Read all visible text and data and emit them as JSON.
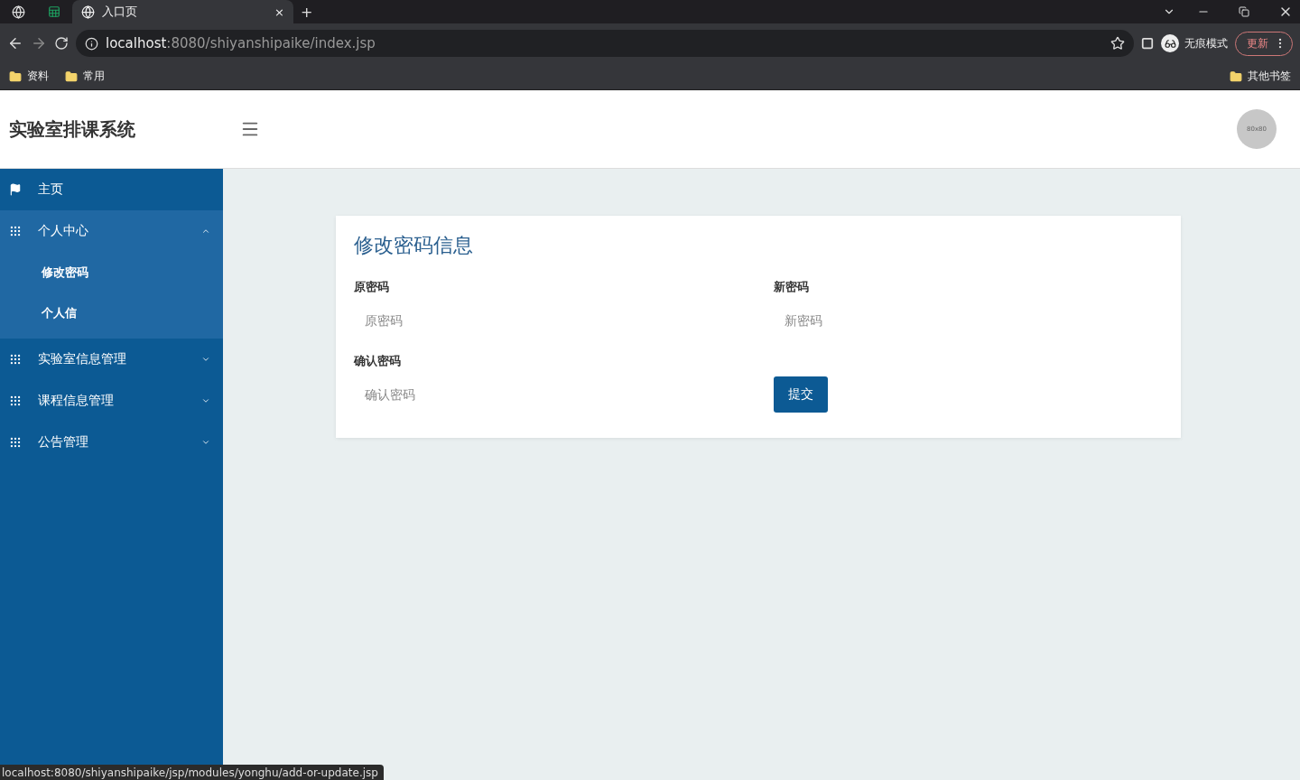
{
  "browser": {
    "tabs": [
      {
        "kind": "pinned",
        "selected": false
      },
      {
        "kind": "pinned",
        "selected": false
      },
      {
        "kind": "tab",
        "title": "入口页",
        "close": "×",
        "selected": true
      }
    ],
    "new_tab": "+",
    "address": {
      "host": "localhost",
      "path": ":8080/shiyanshipaike/index.jsp"
    },
    "incognito": "无痕模式",
    "update": "更新",
    "bookmarks": [
      "资料",
      "常用"
    ],
    "other_bookmarks": "其他书签"
  },
  "app": {
    "title": "实验室排课系统",
    "avatar": "80x80"
  },
  "sidebar": [
    {
      "kind": "link",
      "label": "主页"
    },
    {
      "kind": "group",
      "label": "个人中心",
      "expanded": true,
      "children": [
        {
          "label": "修改密码"
        },
        {
          "label": "个人信"
        }
      ]
    },
    {
      "kind": "group",
      "label": "实验室信息管理",
      "expanded": false
    },
    {
      "kind": "group",
      "label": "课程信息管理",
      "expanded": false
    },
    {
      "kind": "group",
      "label": "公告管理",
      "expanded": false
    }
  ],
  "form": {
    "title": "修改密码信息",
    "fields": [
      {
        "label": "原密码",
        "placeholder": "原密码"
      },
      {
        "label": "新密码",
        "placeholder": "新密码"
      },
      {
        "label": "确认密码",
        "placeholder": "确认密码"
      }
    ],
    "submit": "提交"
  },
  "status_url": "localhost:8080/shiyanshipaike/jsp/modules/yonghu/add-or-update.jsp"
}
